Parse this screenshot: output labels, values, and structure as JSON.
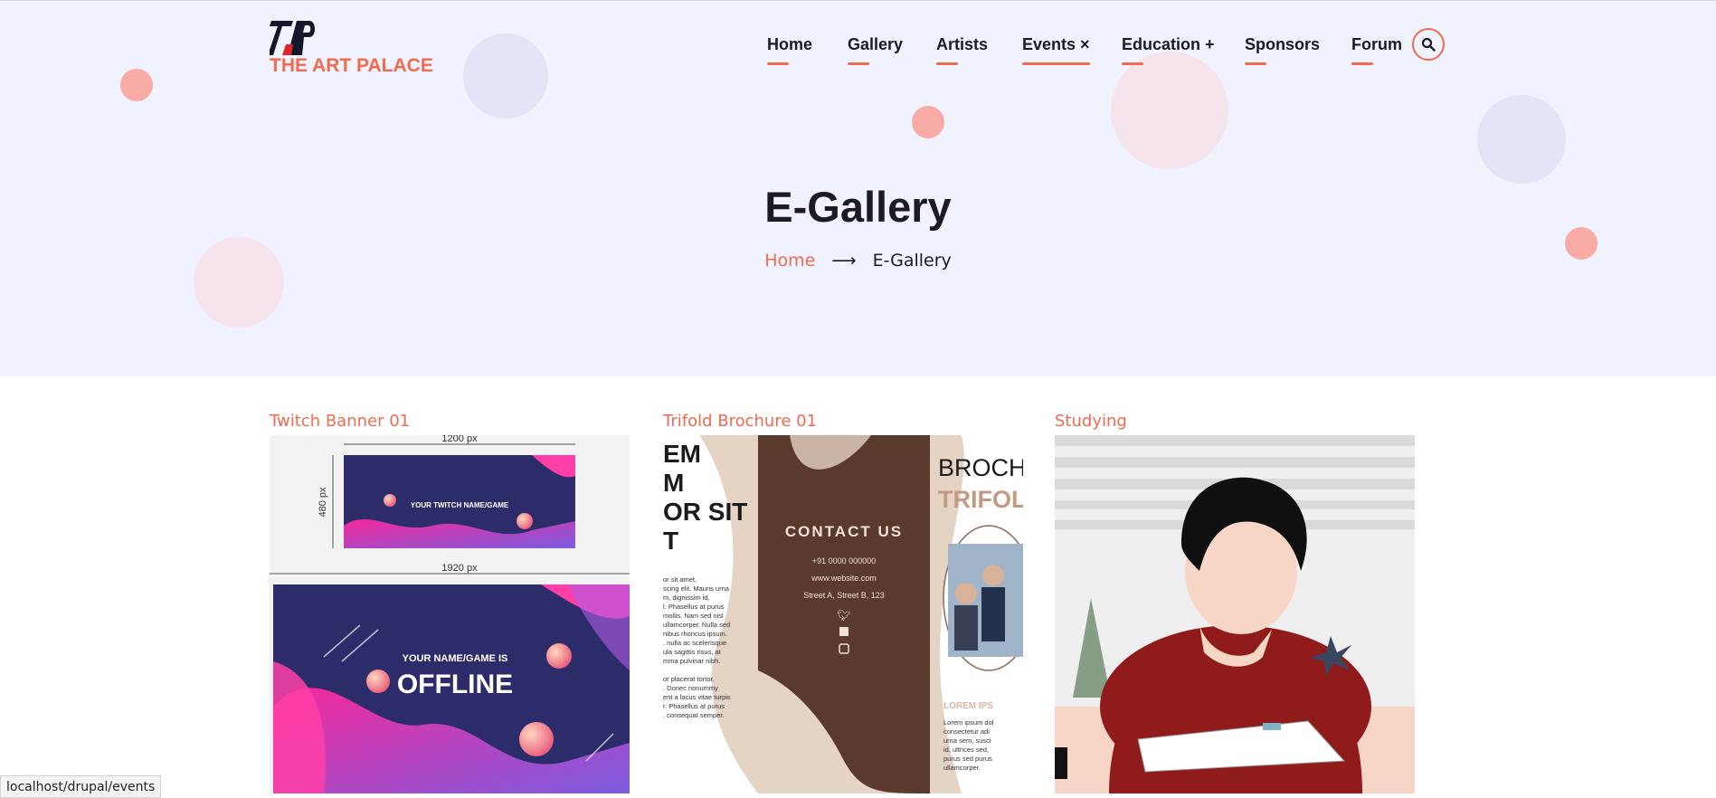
{
  "site": {
    "logo_text": "THE ART PALACE"
  },
  "nav": {
    "items": [
      {
        "label": "Home"
      },
      {
        "label": "Gallery"
      },
      {
        "label": "Artists"
      },
      {
        "label": "Events ×"
      },
      {
        "label": "Education +"
      },
      {
        "label": "Sponsors"
      },
      {
        "label": "Forum"
      }
    ],
    "active": "Events ×",
    "search_icon": "search-icon"
  },
  "hero": {
    "title": "E-Gallery",
    "breadcrumb": {
      "home": "Home",
      "separator": "⟶",
      "current": "E-Gallery"
    }
  },
  "gallery": {
    "cards": [
      {
        "title": "Twitch Banner 01",
        "image_text": {
          "top_width": "1200 px",
          "top_height": "480 px",
          "top_caption": "YOUR TWITCH NAME/GAME",
          "bottom_width": "1920 px",
          "bottom_caption": "YOUR NAME/GAME IS",
          "bottom_headline": "OFFLINE"
        }
      },
      {
        "title": "Trifold Brochure 01",
        "image_text": {
          "left_heading": "EM\nM\nOR SIT\nT",
          "left_body_1": "or sit amet,\nscing elit. Mauris urna\nm, dignissim id,\nl. Phasellus at purus\nmollis. Nam sed nisl\nullamcorper. Nulla sed\nnibus rhoncus ipsum.\n. nulla ac scelerisque\nula sagittis risus, at\nmma pulvinar nibh.",
          "left_body_2": "or placerat tortor.\n. Donec nonummy\nent a lacus vitae turpis\nr. Phasellus at purus\n. consequat semper.",
          "contact_heading": "CONTACT US",
          "phone": "+91 0000 000000",
          "website": "www.website.com",
          "address": "Street A, Street B, 123",
          "right_heading_1": "BROCH",
          "right_heading_2": "TRIFOL",
          "right_lorem": "LOREM IPS",
          "right_body": "Lorem ipsum dol\nconsectetur adi\nurna sem, susci\nid, ultrices sed,\npurus sed purus\nullamcorper."
        }
      },
      {
        "title": "Studying",
        "image_text": {}
      }
    ]
  },
  "status_bar": {
    "url": "localhost/drupal/events"
  },
  "colors": {
    "accent": "#f26a50",
    "hero_bg": "#f0f2fd",
    "text_dark": "#1b1b22"
  }
}
